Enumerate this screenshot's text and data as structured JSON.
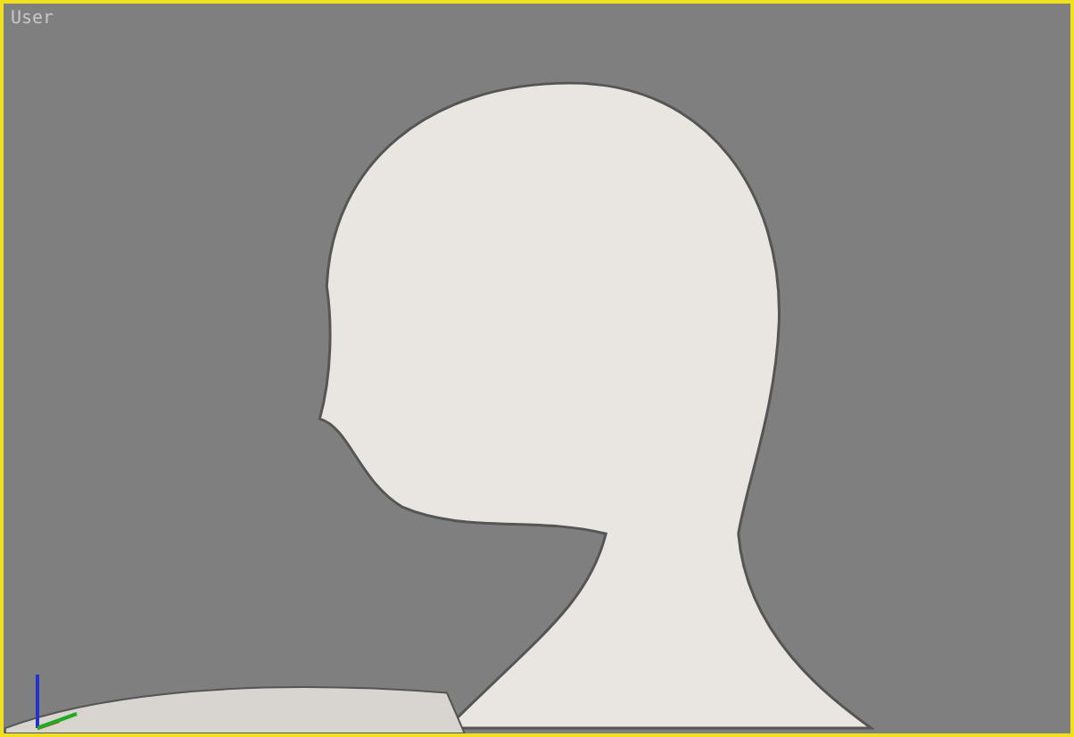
{
  "viewport": {
    "label": "User",
    "active": true
  }
}
